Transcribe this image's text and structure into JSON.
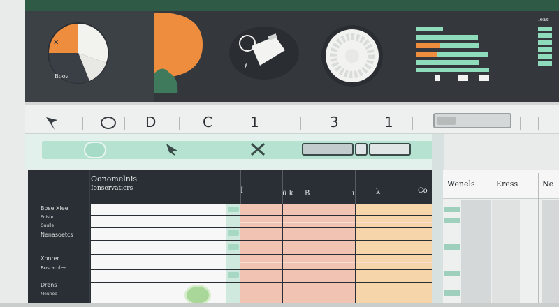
{
  "toolbar": {
    "items": [
      "D",
      "C",
      "1",
      "3",
      "1"
    ]
  },
  "table": {
    "header_title": "Oonomelnis",
    "header_subtitle": "Ionservatiers",
    "col_headers": [
      "İ",
      "ū k",
      "B",
      "ı",
      "k",
      "Co"
    ],
    "row_labels": [
      "Bose Xlee",
      "Eoiste",
      "Oaulle",
      "Nenasoetcs",
      "Xonrer",
      "Bostarolee",
      "Drens",
      "Meunee"
    ]
  },
  "right_panel": {
    "headers": [
      "Wenels",
      "Eress",
      "Ne"
    ],
    "corner_label": "Ieas"
  },
  "colors": {
    "accent_green": "#2f5a46",
    "mint": "#b5e2d1",
    "orange": "#ef8d3e",
    "dark": "#34383d",
    "salmon": "#f1c3b2",
    "peach": "#f7d5ab"
  },
  "icons": [
    "pie-chart-icon",
    "toggle-icon",
    "tag-icon",
    "dial-icon",
    "bar-chart-icon"
  ]
}
